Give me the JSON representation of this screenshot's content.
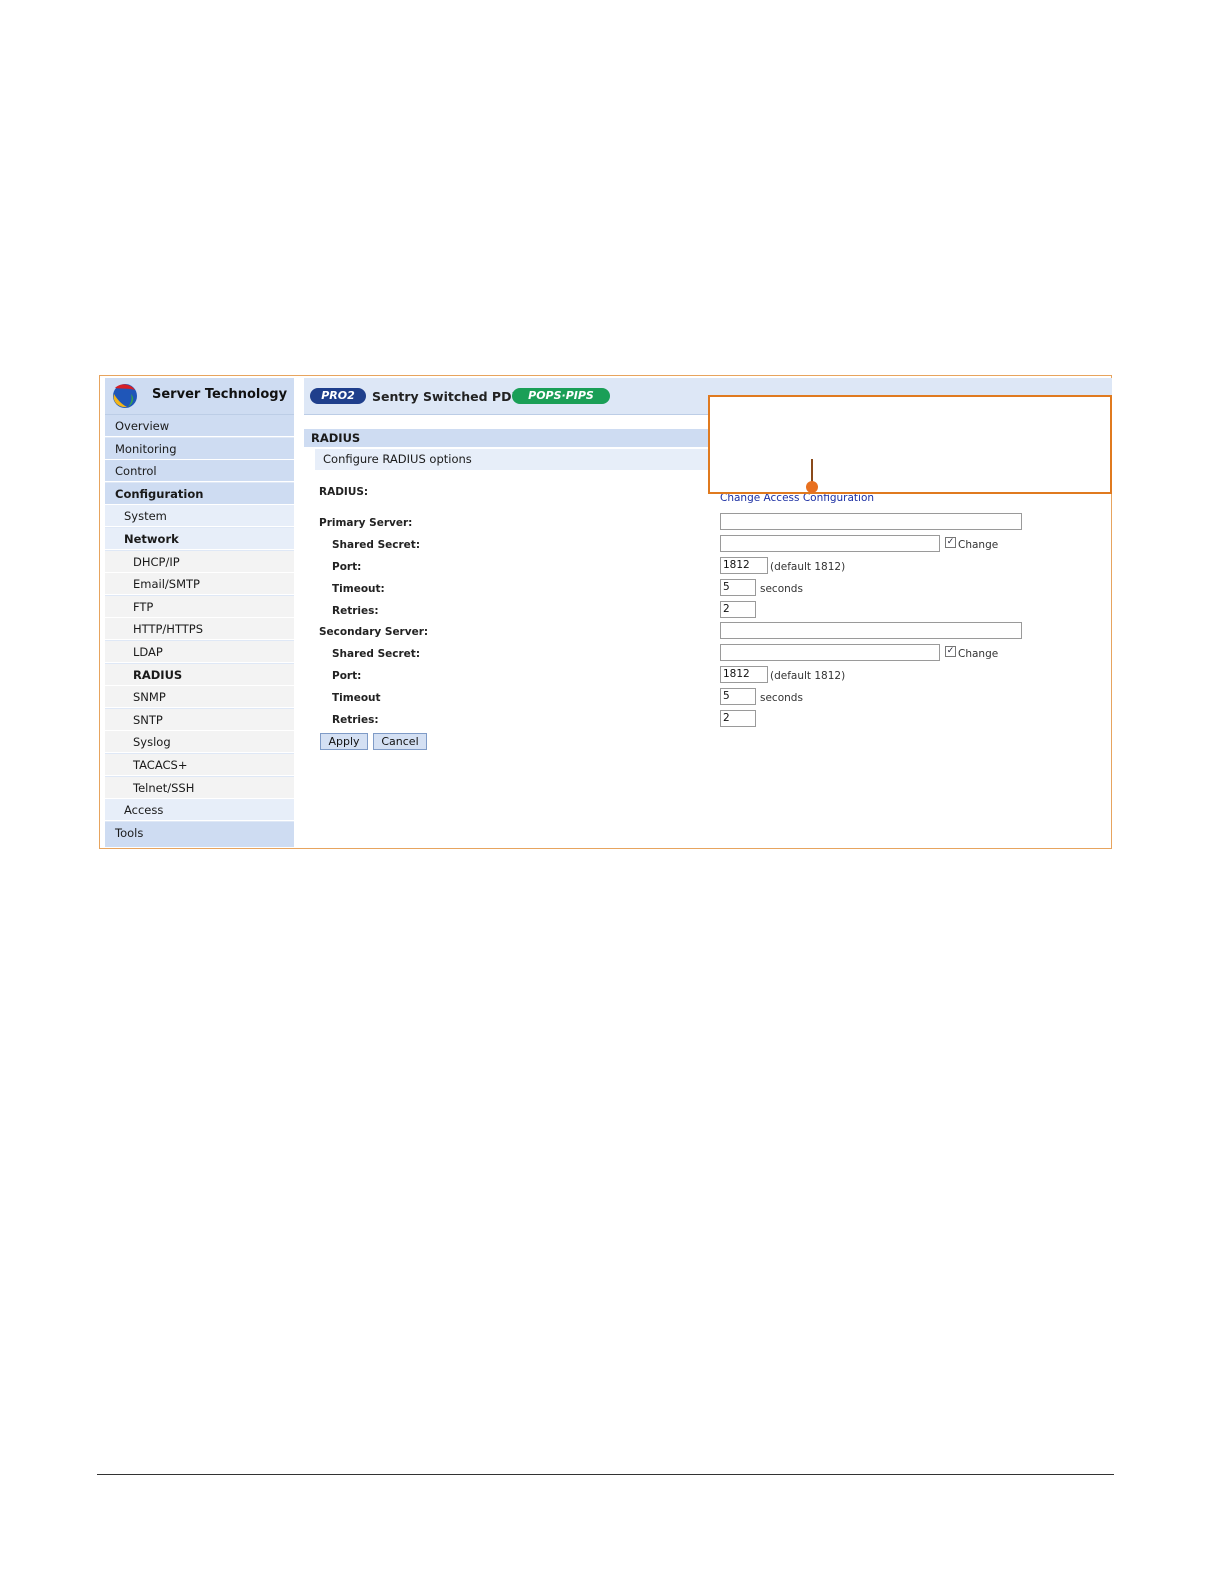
{
  "brand": {
    "name": "Server Technology"
  },
  "header": {
    "pro_badge": "PRO2",
    "product": "Sentry Switched PDU",
    "pops_badge": "POPS·PIPS"
  },
  "nav": {
    "overview": "Overview",
    "monitoring": "Monitoring",
    "control": "Control",
    "configuration": "Configuration",
    "system": "System",
    "network": "Network",
    "dhcp": "DHCP/IP",
    "email": "Email/SMTP",
    "ftp": "FTP",
    "http": "HTTP/HTTPS",
    "ldap": "LDAP",
    "radius": "RADIUS",
    "snmp": "SNMP",
    "sntp": "SNTP",
    "syslog": "Syslog",
    "tacacs": "TACACS+",
    "telnet": "Telnet/SSH",
    "access": "Access",
    "tools": "Tools"
  },
  "section": {
    "title": "RADIUS",
    "subtitle": "Configure RADIUS options"
  },
  "form": {
    "radius_label": "RADIUS:",
    "change_access_link": "Change Access Configuration",
    "primary": {
      "server_label": "Primary Server:",
      "server_value": "",
      "secret_label": "Shared Secret:",
      "secret_value": "",
      "change_label": "Change",
      "port_label": "Port:",
      "port_value": "1812",
      "port_hint": "(default 1812)",
      "timeout_label": "Timeout:",
      "timeout_value": "5",
      "timeout_hint": "seconds",
      "retries_label": "Retries:",
      "retries_value": "2"
    },
    "secondary": {
      "server_label": "Secondary Server:",
      "server_value": "",
      "secret_label": "Shared Secret:",
      "secret_value": "",
      "change_label": "Change",
      "port_label": "Port:",
      "port_value": "1812",
      "port_hint": "(default 1812)",
      "timeout_label": "Timeout",
      "timeout_value": "5",
      "timeout_hint": "seconds",
      "retries_label": "Retries:",
      "retries_value": "2"
    },
    "apply_label": "Apply",
    "cancel_label": "Cancel"
  },
  "colors": {
    "sidebar": "#cedcf2",
    "callout_border": "#e07a1f",
    "frame_border": "#e7a45e",
    "link": "#1c2fa3"
  }
}
